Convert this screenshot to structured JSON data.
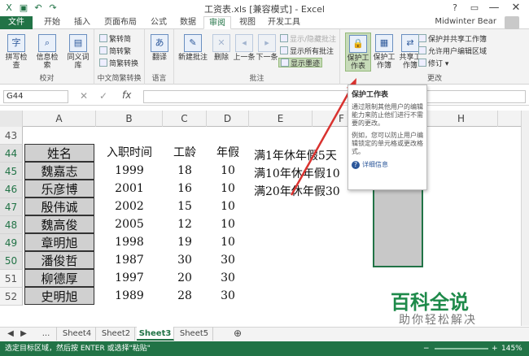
{
  "title": "工资表.xls  [兼容模式] - Excel",
  "window": {
    "help": "?",
    "ribbon_opts": "▭",
    "minimize": "—",
    "maximize": "□",
    "close": "✕"
  },
  "user": "Midwinter Bear",
  "tabs": [
    "文件",
    "开始",
    "插入",
    "页面布局",
    "公式",
    "数据",
    "审阅",
    "视图",
    "开发工具"
  ],
  "ribbon": {
    "groups": [
      "校对",
      "中文简繁转换",
      "语言",
      "批注",
      "更改"
    ],
    "proof": [
      "拼写检查",
      "信息检索",
      "同义词库"
    ],
    "chinese": [
      "繁转简",
      "简转繁",
      "简繁转换"
    ],
    "language": "翻译",
    "comments": {
      "new": "新建批注",
      "delete": "删除",
      "prev": "上一条",
      "next": "下一条",
      "show_hide": "显示/隐藏批注",
      "show_all": "显示所有批注",
      "show_ink": "显示墨迹"
    },
    "changes": {
      "protect_sheet": "保护工作表",
      "protect_wb": "保护工作簿",
      "share_wb": "共享工作簿",
      "protect_share": "保护并共享工作簿",
      "allow_edit": "允许用户编辑区域",
      "track": "修订 ▾"
    }
  },
  "formula": {
    "namebox": "G44",
    "fx": "fx"
  },
  "columns": [
    "A",
    "B",
    "C",
    "D",
    "E",
    "F",
    "G",
    "H"
  ],
  "rows": [
    "43",
    "44",
    "45",
    "46",
    "47",
    "48",
    "49",
    "50",
    "51",
    "52"
  ],
  "header": [
    "姓名",
    "入职时间",
    "工龄",
    "年假"
  ],
  "table": [
    [
      "魏嘉志",
      "1999",
      "18",
      "10"
    ],
    [
      "乐彦博",
      "2001",
      "16",
      "10"
    ],
    [
      "殷伟诚",
      "2002",
      "15",
      "10"
    ],
    [
      "魏高俊",
      "2005",
      "12",
      "10"
    ],
    [
      "章明旭",
      "1998",
      "19",
      "10"
    ],
    [
      "潘俊哲",
      "1987",
      "30",
      "30"
    ],
    [
      "柳德厚",
      "1997",
      "20",
      "30"
    ],
    [
      "史明旭",
      "1989",
      "28",
      "30"
    ]
  ],
  "notes": [
    "满1年休年假5天",
    "满10年休年假10",
    "满20年休年假30"
  ],
  "tooltip": {
    "title": "保护工作表",
    "p1": "通过限制其他用户的编辑能力来防止他们进行不需要的更改。",
    "p2": "例如，您可以防止用户编辑锁定的单元格或更改格式。",
    "link": "详细信息"
  },
  "sheets": [
    "Sheet4",
    "Sheet2",
    "Sheet3",
    "Sheet5"
  ],
  "sheet_nav": {
    "prev": "◀",
    "next": "▶",
    "more": "...",
    "add": "⊕"
  },
  "status": {
    "text": "选定目标区域，然后按 ENTER 或选择\"粘贴\"",
    "zoom": "145%",
    "minus": "−",
    "plus": "+"
  },
  "watermark": {
    "line1": "百科全说",
    "line2": "助你轻松解决"
  },
  "colors": {
    "accent": "#217346",
    "arrow": "#d9322f"
  }
}
